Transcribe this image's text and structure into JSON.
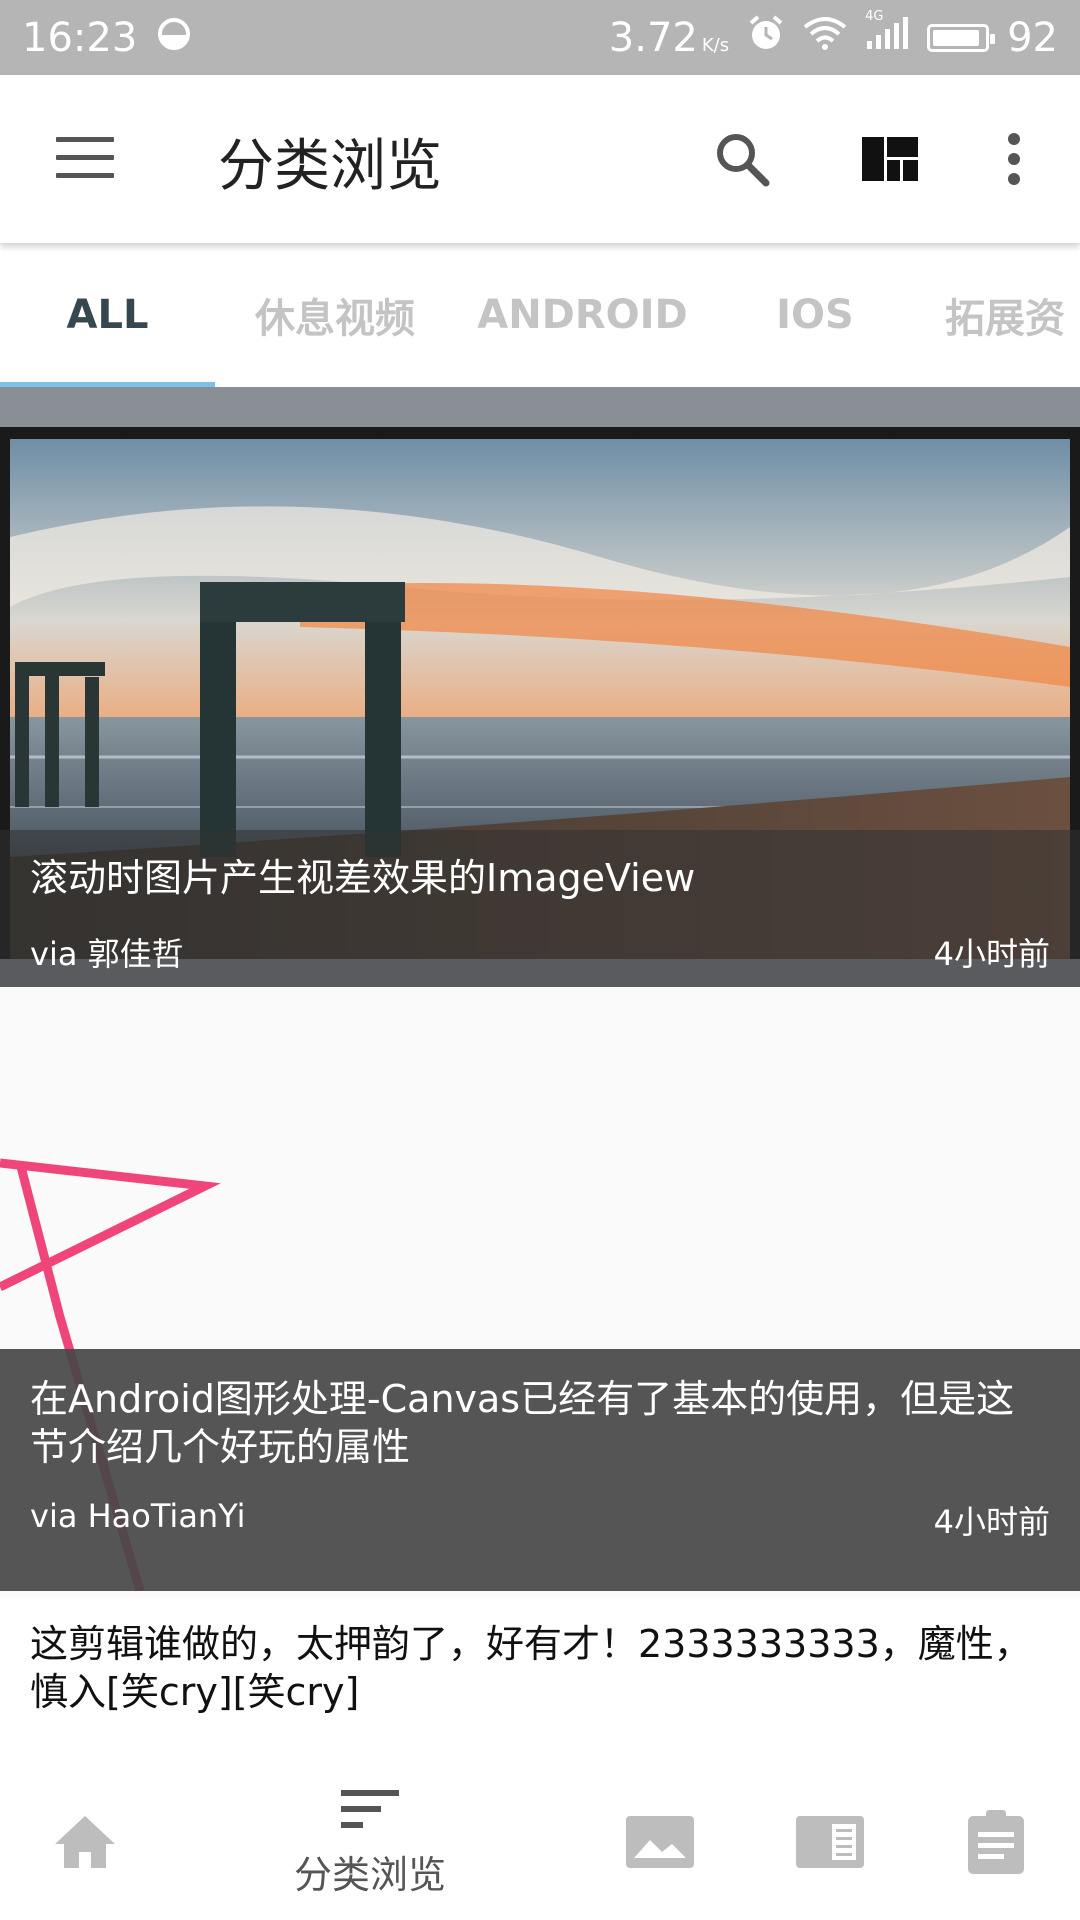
{
  "status_bar": {
    "time": "16:23",
    "speed": "3.72",
    "speed_unit": "K/s",
    "network": "4G",
    "battery": "92",
    "battery_level": 0.92
  },
  "toolbar": {
    "title": "分类浏览",
    "icons": [
      "menu-icon",
      "search-icon",
      "layout-grid-icon",
      "more-vert-icon"
    ]
  },
  "tabs": [
    {
      "label": "ALL",
      "active": true
    },
    {
      "label": "休息视频",
      "active": false
    },
    {
      "label": "ANDROID",
      "active": false
    },
    {
      "label": "IOS",
      "active": false
    },
    {
      "label": "拓展资",
      "active": false
    }
  ],
  "feed": {
    "items": [
      {
        "title": "滚动时图片产生视差效果的ImageView",
        "author": "via 郭佳哲",
        "time": "4小时前"
      },
      {
        "title": "在Android图形处理-Canvas已经有了基本的使用，但是这节介绍几个好玩的属性",
        "author": "via HaoTianYi",
        "time": "4小时前"
      },
      {
        "title": "这剪辑谁做的，太押韵了，好有才！2333333333，魔性，慎入[笑cry][笑cry]"
      }
    ]
  },
  "bottom_nav": {
    "active_label": "分类浏览",
    "icons": [
      "home-icon",
      "sort-icon",
      "image-icon",
      "reader-icon",
      "clipboard-icon"
    ]
  },
  "colors": {
    "status_bar": "#b5b5b5",
    "tab_indicator": "#7fbfe8",
    "tab_active": "#37474f",
    "tab_inactive": "#c4c4c4",
    "star_pink": "#f0457a"
  }
}
